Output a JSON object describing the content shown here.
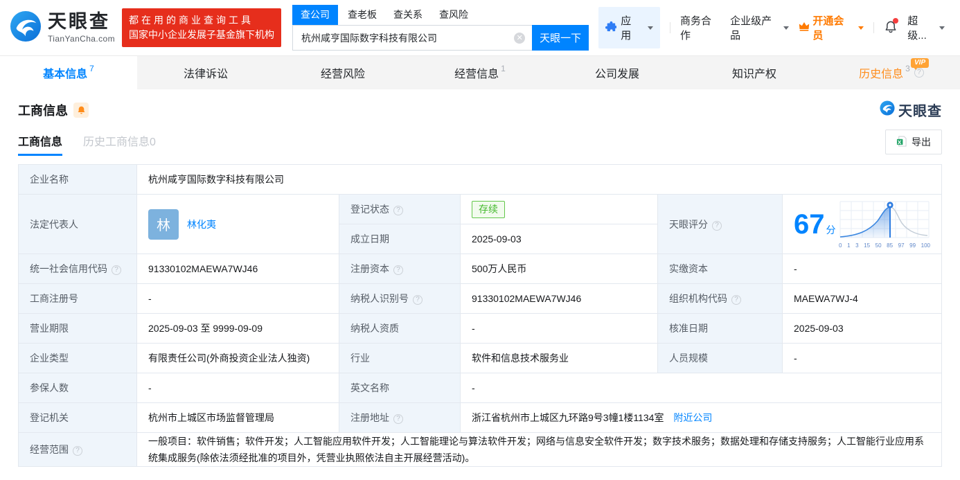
{
  "brand": {
    "logo_title": "天眼查",
    "logo_subtitle": "TianYanCha.com",
    "promo_line1": "都在用的商业查询工具",
    "promo_line2": "国家中小企业发展子基金旗下机构",
    "colors": {
      "primary_blue": "#0084ff",
      "promo_red": "#e62e1c",
      "vip_orange": "#ff7a00",
      "status_green": "#44b92d"
    }
  },
  "search": {
    "tabs": [
      "查公司",
      "查老板",
      "查关系",
      "查风险"
    ],
    "active_tab": "查公司",
    "input_value": "杭州咸亨国际数字科技有限公司",
    "button_label": "天眼一下"
  },
  "top_nav": {
    "apps": "应用",
    "business_coop": "商务合作",
    "enterprise_products": "企业级产品",
    "vip": "开通会员",
    "super": "超级..."
  },
  "page_tabs": [
    {
      "label": "基本信息",
      "count": "7"
    },
    {
      "label": "法律诉讼",
      "count": ""
    },
    {
      "label": "经营风险",
      "count": ""
    },
    {
      "label": "经营信息",
      "count": "1"
    },
    {
      "label": "公司发展",
      "count": ""
    },
    {
      "label": "知识产权",
      "count": ""
    },
    {
      "label": "历史信息",
      "count": "3",
      "vip_label": "VIP"
    }
  ],
  "section": {
    "title": "工商信息",
    "subtab_active": "工商信息",
    "subtab_history": "历史工商信息0",
    "export_label": "导出",
    "watermark": "天眼查"
  },
  "fields": {
    "company_name": {
      "label": "企业名称",
      "value": "杭州咸亨国际数字科技有限公司"
    },
    "legal_rep": {
      "label": "法定代表人",
      "avatar": "林",
      "value": "林化夷"
    },
    "reg_status": {
      "label": "登记状态",
      "value": "存续"
    },
    "establish_date": {
      "label": "成立日期",
      "value": "2025-09-03"
    },
    "tyc_score": {
      "label": "天眼评分",
      "score": "67",
      "unit": "分"
    },
    "credit_code": {
      "label": "统一社会信用代码",
      "value": "91330102MAEWA7WJ46"
    },
    "reg_capital": {
      "label": "注册资本",
      "value": "500万人民币"
    },
    "paid_capital": {
      "label": "实缴资本",
      "value": "-"
    },
    "reg_number": {
      "label": "工商注册号",
      "value": "-"
    },
    "taxpayer_id": {
      "label": "纳税人识别号",
      "value": "91330102MAEWA7WJ46"
    },
    "org_code": {
      "label": "组织机构代码",
      "value": "MAEWA7WJ-4"
    },
    "business_term": {
      "label": "营业期限",
      "value": "2025-09-03 至 9999-09-09"
    },
    "taxpayer_quality": {
      "label": "纳税人资质",
      "value": "-"
    },
    "approval_date": {
      "label": "核准日期",
      "value": "2025-09-03"
    },
    "company_type": {
      "label": "企业类型",
      "value": "有限责任公司(外商投资企业法人独资)"
    },
    "industry": {
      "label": "行业",
      "value": "软件和信息技术服务业"
    },
    "staff_size": {
      "label": "人员规模",
      "value": "-"
    },
    "insured_count": {
      "label": "参保人数",
      "value": "-"
    },
    "english_name": {
      "label": "英文名称",
      "value": "-"
    },
    "reg_authority": {
      "label": "登记机关",
      "value": "杭州市上城区市场监督管理局"
    },
    "reg_address": {
      "label": "注册地址",
      "value": "浙江省杭州市上城区九环路9号3幢1楼1134室",
      "link": "附近公司"
    },
    "business_scope": {
      "label": "经营范围",
      "value": "一般项目：软件销售；软件开发；人工智能应用软件开发；人工智能理论与算法软件开发；网络与信息安全软件开发；数字技术服务；数据处理和存储支持服务；人工智能行业应用系统集成服务(除依法须经批准的项目外，凭营业执照依法自主开展经营活动)。"
    }
  },
  "score_chart": {
    "type": "area",
    "score": 67,
    "ticks": [
      "0",
      "1",
      "3",
      "15",
      "50",
      "85",
      "97",
      "99",
      "100"
    ]
  }
}
